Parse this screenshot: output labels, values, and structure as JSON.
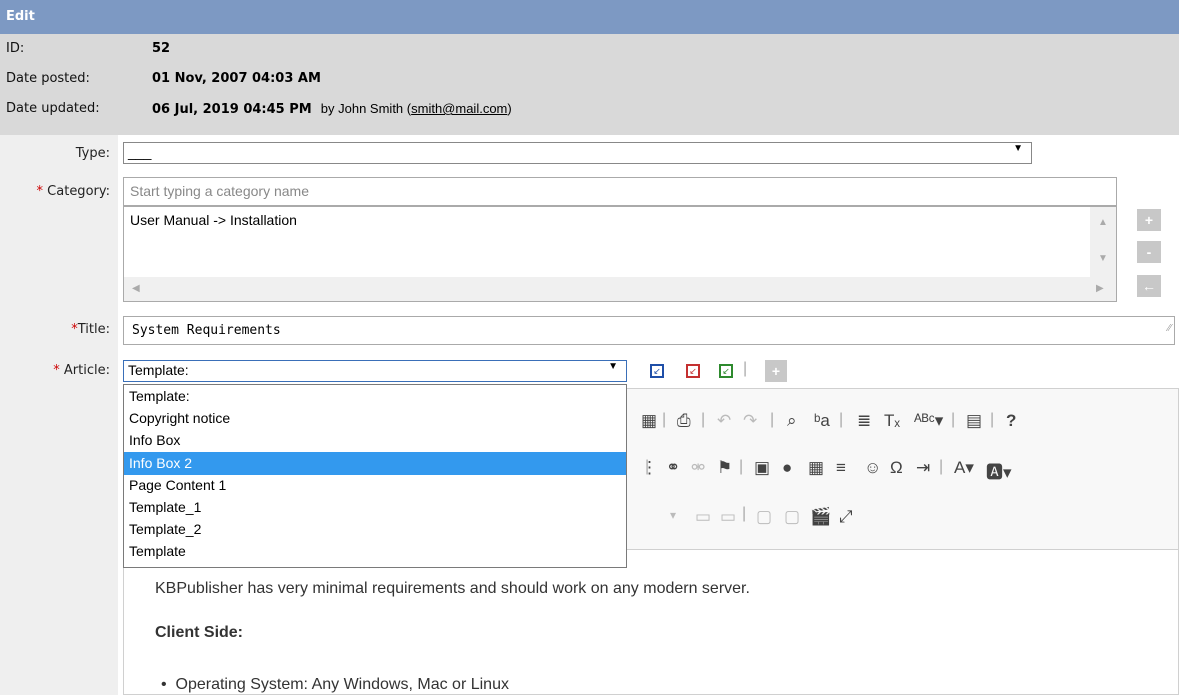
{
  "header": {
    "title": "Edit"
  },
  "info": {
    "id_label": "ID:",
    "id_value": "52",
    "posted_label": "Date posted:",
    "posted_value": "01 Nov, 2007 04:03 AM",
    "updated_label": "Date updated:",
    "updated_value": "06 Jul, 2019 04:45 PM",
    "updated_by": "by John Smith (",
    "updated_email": "smith@mail.com",
    "updated_close": ")"
  },
  "form": {
    "type_label": "Type:",
    "type_value": "___",
    "category_label": "Category:",
    "category_placeholder": "Start typing a category name",
    "category_selected": "User Manual -> Installation",
    "title_label": "Title:",
    "title_value": "System Requirements",
    "article_label": "Article:",
    "template_value": "Template:",
    "required_mark": "*"
  },
  "side_buttons": {
    "add": "+",
    "remove": "-",
    "back": "←"
  },
  "template_options": [
    "Template:",
    "Copyright notice",
    "Info Box",
    "Info Box 2",
    "Page Content 1",
    "Template_1",
    "Template_2",
    "Template"
  ],
  "template_selected_index": 3,
  "editor": {
    "content_intro": "KBPublisher has very minimal requirements and should work on any modern server.",
    "heading_client": "Client Side:",
    "bullet_os": "Operating System: Any Windows, Mac or Linux"
  },
  "colors": {
    "titlebar": "#7d99c3",
    "info_bg": "#d9d9d9",
    "selected_option": "#3399ee",
    "required": "#cc0000"
  }
}
